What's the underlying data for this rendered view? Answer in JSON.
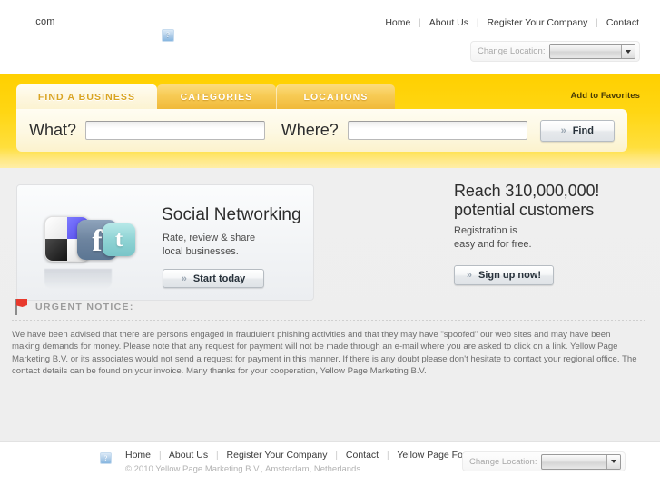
{
  "header": {
    "logo_text": ".com",
    "broken_image_glyph": "?",
    "nav": [
      {
        "label": "Home"
      },
      {
        "label": "About Us"
      },
      {
        "label": "Register Your Company"
      },
      {
        "label": "Contact"
      }
    ],
    "separator": "|",
    "location": {
      "label": "Change Location:",
      "selected": ""
    }
  },
  "search": {
    "tabs": [
      {
        "label": "FIND A BUSINESS",
        "active": true
      },
      {
        "label": "CATEGORIES",
        "active": false
      },
      {
        "label": "LOCATIONS",
        "active": false
      }
    ],
    "add_to_favorites": "Add to Favorites",
    "what_label": "What?",
    "what_value": "",
    "where_label": "Where?",
    "where_value": "",
    "find_label": "Find",
    "chevron": "»"
  },
  "social_card": {
    "title": "Social Networking",
    "subtitle_line1": "Rate, review & share",
    "subtitle_line2": "local businesses.",
    "button_label": "Start today",
    "chevron": "»",
    "icons": [
      {
        "name": "msn-squares-icon"
      },
      {
        "name": "facebook-icon",
        "glyph": "f"
      },
      {
        "name": "twitter-icon",
        "glyph": "t"
      }
    ]
  },
  "promo": {
    "title_line1": "Reach 310,000,000!",
    "title_line2": "potential customers",
    "sub_line1": "Registration is",
    "sub_line2": "easy and for free.",
    "button_label": "Sign up now!",
    "chevron": "»"
  },
  "notice": {
    "title": "URGENT NOTICE:",
    "body": "We have been advised that there are persons engaged in fraudulent phishing activities and that they may have \"spoofed\" our web sites and may have been making demands for money. Please note that any request for payment will not be made through an e-mail where you are asked to click on a link. Yellow Page Marketing B.V. or its associates would not send a request for payment in this manner. If there is any doubt please don't hesitate to contact your regional office. The contact details can be found on your invoice. Many thanks for your cooperation, Yellow Page Marketing B.V."
  },
  "footer": {
    "broken_image_glyph": "?",
    "nav": [
      {
        "label": "Home"
      },
      {
        "label": "About Us"
      },
      {
        "label": "Register Your Company"
      },
      {
        "label": "Contact"
      },
      {
        "label": "Yellow Page Forum"
      }
    ],
    "separator": "|",
    "copyright": "© 2010 Yellow Page Marketing B.V., Amsterdam, Netherlands",
    "location": {
      "label": "Change Location:",
      "selected": ""
    }
  },
  "colors": {
    "yellow_band": "#ffd416",
    "tab_active_text": "#d9a422",
    "notice_flag": "#e8392c",
    "page_bg": "#eeeeee"
  }
}
